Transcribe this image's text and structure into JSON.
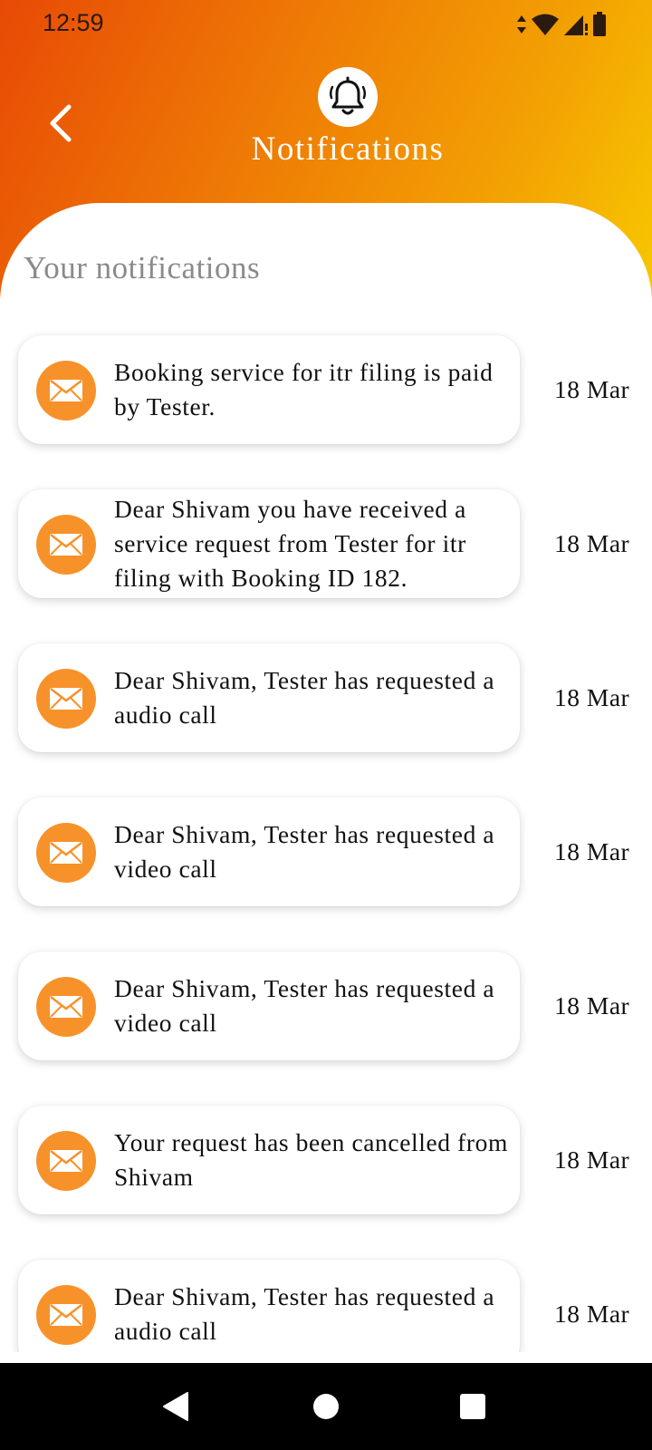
{
  "status_bar": {
    "time": "12:59",
    "icons": [
      "data-arrows-icon",
      "wifi-icon",
      "signal-icon",
      "battery-icon"
    ]
  },
  "header": {
    "title": "Notifications",
    "back_icon": "chevron-left-icon",
    "header_icon": "bell-icon",
    "gradient": [
      "#e84a05",
      "#f7c800"
    ]
  },
  "section": {
    "heading": "Your notifications"
  },
  "notifications": [
    {
      "message": "Booking service for itr filing is paid by Tester.",
      "date": "18 Mar",
      "icon": "mail-icon"
    },
    {
      "message": "Dear Shivam you have received a service request from Tester for itr filing with Booking ID 182.",
      "date": "18 Mar",
      "icon": "mail-icon"
    },
    {
      "message": "Dear Shivam, Tester has requested a audio call",
      "date": "18 Mar",
      "icon": "mail-icon"
    },
    {
      "message": "Dear Shivam, Tester has requested a video call",
      "date": "18 Mar",
      "icon": "mail-icon"
    },
    {
      "message": "Dear Shivam, Tester has requested a video call",
      "date": "18 Mar",
      "icon": "mail-icon"
    },
    {
      "message": "Your request has been cancelled from Shivam",
      "date": "18 Mar",
      "icon": "mail-icon"
    },
    {
      "message": "Dear Shivam, Tester has requested a audio call",
      "date": "18 Mar",
      "icon": "mail-icon"
    }
  ],
  "nav_bar": {
    "buttons": [
      "back-triangle-icon",
      "home-circle-icon",
      "recents-square-icon"
    ]
  },
  "colors": {
    "accent": "#f7922a",
    "nav_background": "#000000",
    "heading_gray": "#8a8a8a"
  }
}
